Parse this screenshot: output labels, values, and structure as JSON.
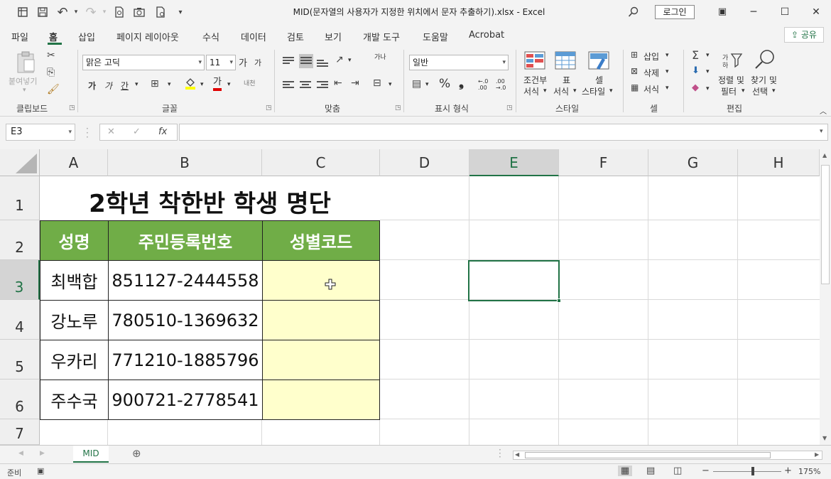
{
  "app": {
    "title": "MID(문자열의 사용자가 지정한 위치에서 문자 추출하기).xlsx  -  Excel",
    "login_label": "로그인",
    "window_min": "─",
    "window_max": "☐",
    "window_close": "✕",
    "ribbon_display": "▣"
  },
  "quick_access": {
    "undo_glyph": "↶",
    "redo_glyph": "↷",
    "customize_glyph": "▾"
  },
  "tabs": {
    "file": "파일",
    "home": "홈",
    "insert": "삽입",
    "page_layout": "페이지 레이아웃",
    "formulas": "수식",
    "data": "데이터",
    "review": "검토",
    "view": "보기",
    "developer": "개발 도구",
    "help": "도움말",
    "acrobat": "Acrobat",
    "share": "공유"
  },
  "ribbon": {
    "clipboard": {
      "paste": "붙여넣기",
      "label": "클립보드"
    },
    "font": {
      "name": "맑은 고딕",
      "size": "11",
      "grow": "가",
      "shrink": "가",
      "bold": "가",
      "italic": "가",
      "underline": "간",
      "font_color_glyph": "가",
      "phonetic": "내천",
      "label": "글꼴"
    },
    "alignment": {
      "label": "맞춤",
      "wrap": "가나"
    },
    "number": {
      "format": "일반",
      "percent": "%",
      "comma": "❟",
      "label": "표시 형식"
    },
    "styles": {
      "conditional": "조건부",
      "conditional2": "서식",
      "table": "표",
      "table2": "서식",
      "cell": "셀",
      "cell2": "스타일",
      "label": "스타일"
    },
    "cells": {
      "insert": "삽입",
      "delete": "삭제",
      "format": "서식",
      "label": "셀"
    },
    "editing": {
      "sort": "정렬 및",
      "sort2": "필터",
      "find": "찾기 및",
      "find2": "선택",
      "label": "편집"
    }
  },
  "formula_bar": {
    "name_box": "E3",
    "cancel": "✕",
    "enter": "✓",
    "fx": "fx",
    "formula": ""
  },
  "columns": [
    "A",
    "B",
    "C",
    "D",
    "E",
    "F",
    "G",
    "H"
  ],
  "rows": [
    "1",
    "2",
    "3",
    "4",
    "5",
    "6",
    "7"
  ],
  "sheet": {
    "title": "2학년 착한반 학생 명단",
    "headers": [
      "성명",
      "주민등록번호",
      "성별코드"
    ],
    "records": [
      {
        "name": "최백합",
        "id": "851127-2444558"
      },
      {
        "name": "강노루",
        "id": "780510-1369632"
      },
      {
        "name": "우카리",
        "id": "771210-1885796"
      },
      {
        "name": "주수국",
        "id": "900721-2778541"
      }
    ]
  },
  "sheet_tabs": {
    "active": "MID",
    "add_glyph": "⊕"
  },
  "status": {
    "ready": "준비",
    "zoom": "175%",
    "zoom_minus": "−",
    "zoom_plus": "+"
  },
  "colors": {
    "accent": "#217346",
    "header_fill": "#70ad47",
    "input_fill": "#ffffcc"
  }
}
